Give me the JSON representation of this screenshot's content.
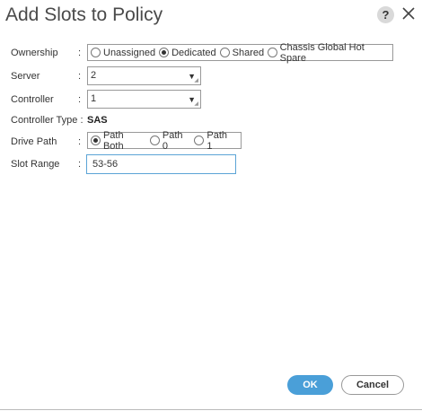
{
  "dialog": {
    "title": "Add Slots to Policy",
    "help_label": "?"
  },
  "fields": {
    "colon": ":",
    "ownership": {
      "label": "Ownership",
      "options": [
        "Unassigned",
        "Dedicated",
        "Shared",
        "Chassis Global Hot Spare"
      ],
      "selected": "Dedicated"
    },
    "server": {
      "label": "Server",
      "value": "2"
    },
    "controller": {
      "label": "Controller",
      "value": "1"
    },
    "controller_type": {
      "label": "Controller Type :",
      "value": "SAS"
    },
    "drive_path": {
      "label": "Drive Path",
      "options": [
        "Path Both",
        "Path 0",
        "Path 1"
      ],
      "selected": "Path Both"
    },
    "slot_range": {
      "label": "Slot Range",
      "value": "53-56"
    }
  },
  "footer": {
    "ok_label": "OK",
    "cancel_label": "Cancel"
  },
  "colors": {
    "primary": "#4a9fd8",
    "focus_border": "#5ba4d6"
  }
}
